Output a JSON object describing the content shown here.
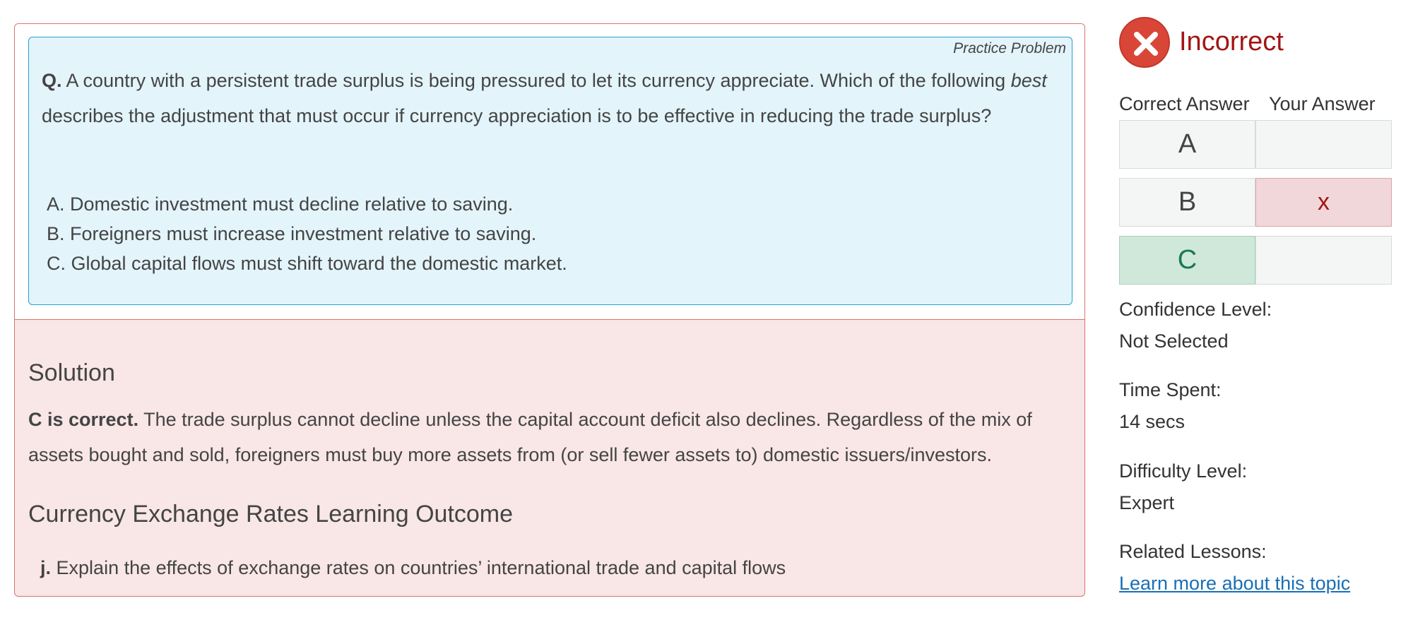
{
  "question": {
    "practice_label": "Practice Problem",
    "q_prefix": "Q.",
    "text_part1": "A country with a persistent trade surplus is being pressured to let its currency appreciate. Which of the following",
    "text_emphasis": "best",
    "text_part2": "describes the adjustment that must occur if currency appreciation is to be effective in reducing the trade surplus?",
    "options": [
      "A. Domestic investment must decline relative to saving.",
      "B. Foreigners must increase investment relative to saving.",
      "C. Global capital flows must shift toward the domestic market."
    ]
  },
  "solution": {
    "heading": "Solution",
    "verdict": "C is correct.",
    "text": "The trade surplus cannot decline unless the capital account deficit also declines. Regardless of the mix of assets bought and sold, foreigners must buy more assets from (or sell fewer assets to) domestic issuers/investors."
  },
  "learning_outcome": {
    "heading": "Currency Exchange Rates Learning Outcome",
    "item_prefix": "j.",
    "item_text": "Explain the effects of exchange rates on countries’ international trade and capital flows"
  },
  "sidebar": {
    "status": "Incorrect",
    "correct_answer_header": "Correct Answer",
    "your_answer_header": "Your Answer",
    "rows": [
      {
        "letter": "A",
        "correct": false,
        "selected": false,
        "mark": ""
      },
      {
        "letter": "B",
        "correct": false,
        "selected": true,
        "mark": "x"
      },
      {
        "letter": "C",
        "correct": true,
        "selected": false,
        "mark": ""
      }
    ],
    "confidence_label": "Confidence Level:",
    "confidence_value": "Not Selected",
    "time_label": "Time Spent:",
    "time_value": "14 secs",
    "difficulty_label": "Difficulty Level:",
    "difficulty_value": "Expert",
    "related_label": "Related Lessons:",
    "related_link": "Learn more about this topic"
  },
  "colors": {
    "incorrect": "#a31515",
    "correct": "#1a7a4f",
    "link": "#1a6fb5",
    "question_bg": "#e3f4fb",
    "solution_bg": "#f9e6e6"
  },
  "icons": {
    "status": "close-circle-icon"
  }
}
